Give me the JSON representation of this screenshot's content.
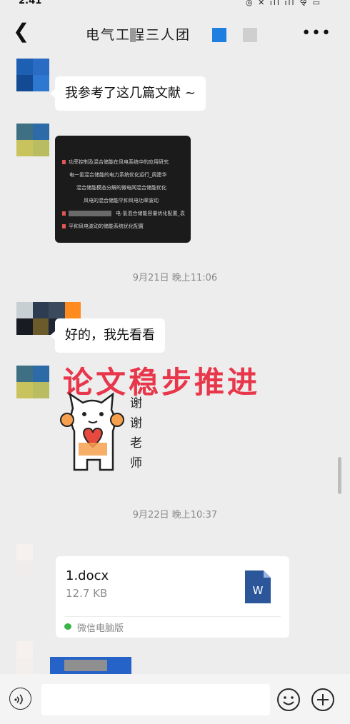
{
  "status_bar": {
    "time": "2:41",
    "icons": "◎ ✕ ıll ıll 令 ▭"
  },
  "header": {
    "back_icon": "chevron-left-icon",
    "title": "电气工程三人团",
    "more_icon": "more-dots-icon"
  },
  "messages": {
    "m1_text": "我参考了这几篇文献 ~",
    "image_lines": [
      "功率控制及混合储能在风电系统中的应用研究",
      "电一氢混合储能的电力系统优化运行_周建华",
      "混合储能模态分解的微电网混合储能优化",
      "风电的混合储能平抑风电功率波动",
      "电-氢混合储能容量优化配置_袁",
      "平抑风电波动的储能系统优化配置"
    ],
    "ts1": "9月21日 晚上11:06",
    "m2_text": "好的，我先看看",
    "overlay": "论文稳步推进",
    "sticker_text": [
      "谢",
      "谢",
      "老",
      "师"
    ],
    "ts2": "9月22日 晚上10:37",
    "file": {
      "name": "1.docx",
      "size": "12.7 KB",
      "source": "微信电脑版",
      "icon_letter": "W"
    }
  },
  "input_bar": {
    "voice_icon": "voice-icon",
    "emoji_icon": "emoji-icon",
    "plus_icon": "plus-icon"
  },
  "colors": {
    "background": "#ededed",
    "bubble": "#ffffff",
    "overlay_red": "#e8374a",
    "word_blue": "#2b579a",
    "wechat_green": "#3ab54a"
  }
}
